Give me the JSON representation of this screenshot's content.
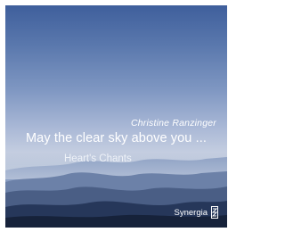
{
  "album": {
    "artist": "Christine Ranzinger",
    "title": "May the clear sky above you ...",
    "subtitle": "Heart's Chants",
    "label": "Synergia",
    "logo_icon": "synergia-logo-icon"
  },
  "colors": {
    "sky_top": "#3f5f9c",
    "sky_horizon": "#c4cde0",
    "mountains_far": "#7a8fb5",
    "mountains_mid": "#5a6f95",
    "mountains_near": "#2f3f5f",
    "mountains_front": "#1c2a45",
    "text": "#ffffff"
  }
}
